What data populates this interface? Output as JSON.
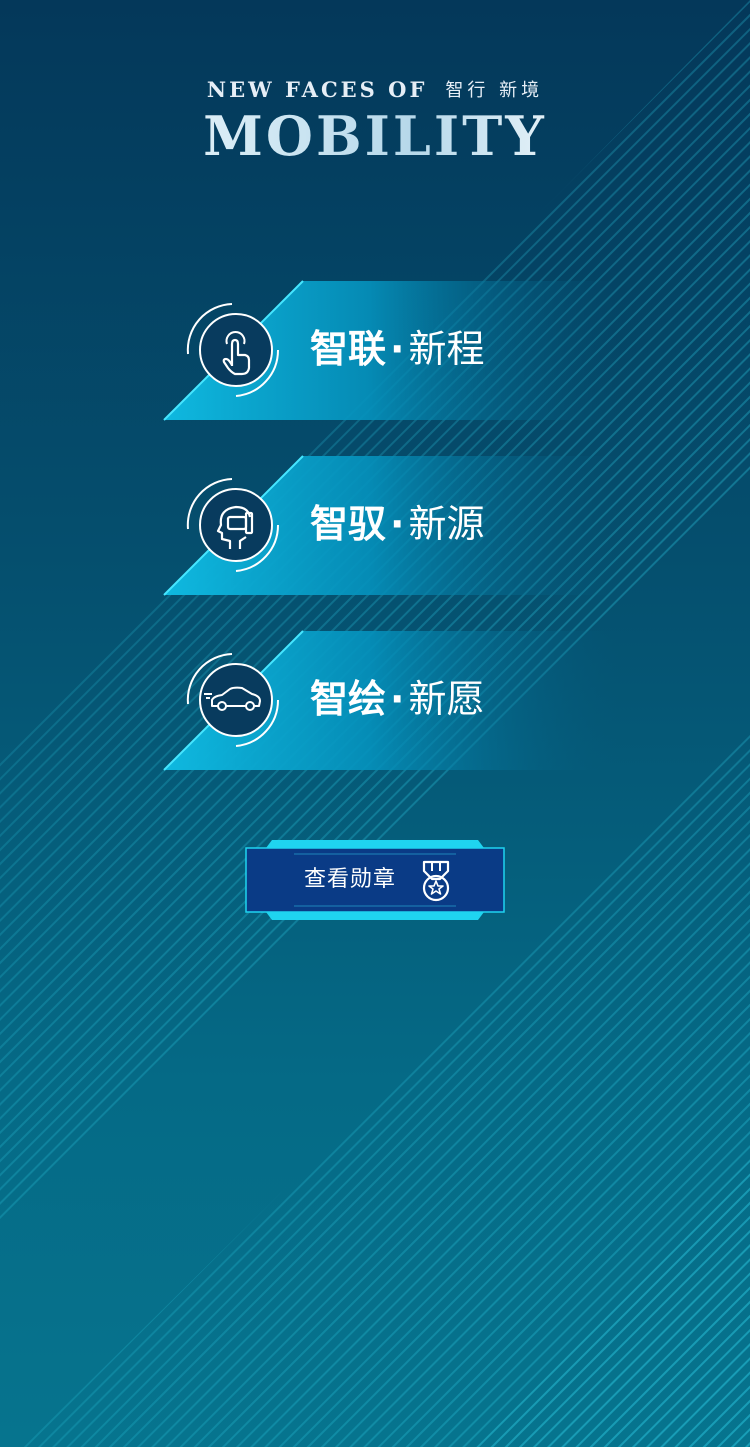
{
  "header": {
    "line1_en": "NEW FACES OF",
    "line1_cn": "智行 新境",
    "brand": "MOBILITY"
  },
  "menu": [
    {
      "icon": "touch-hand-icon",
      "bold": "智联",
      "dot": "·",
      "light": "新程"
    },
    {
      "icon": "vr-head-icon",
      "bold": "智驭",
      "dot": "·",
      "light": "新源"
    },
    {
      "icon": "car-icon",
      "bold": "智绘",
      "dot": "·",
      "light": "新愿"
    }
  ],
  "badge_button": {
    "label": "查看勋章",
    "icon": "medal-icon"
  },
  "colors": {
    "accent": "#17c6e8",
    "button_bg": "#093a86",
    "card_cyan": "#0fb0d8"
  }
}
